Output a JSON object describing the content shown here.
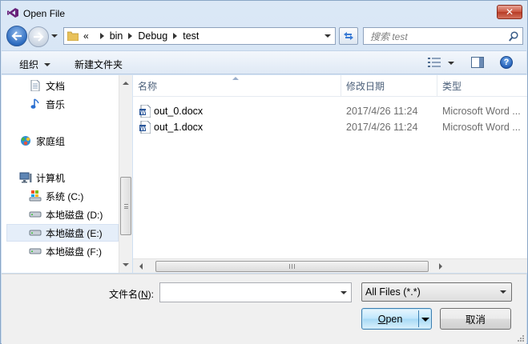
{
  "window": {
    "title": "Open File"
  },
  "nav": {
    "address": {
      "overflow": "«",
      "crumbs": [
        "bin",
        "Debug",
        "test"
      ]
    },
    "search": {
      "placeholder": "搜索 test"
    }
  },
  "toolbar": {
    "organize": "组织",
    "new_folder": "新建文件夹"
  },
  "sidebar": {
    "items": [
      {
        "label": "文档",
        "icon": "document-icon",
        "selected": false
      },
      {
        "label": "音乐",
        "icon": "music-icon",
        "selected": false
      },
      {
        "label": "家庭组",
        "icon": "homegroup-icon",
        "selected": false
      },
      {
        "label": "计算机",
        "icon": "computer-icon",
        "selected": false
      },
      {
        "label": "系统 (C:)",
        "icon": "system-drive-icon",
        "selected": false
      },
      {
        "label": "本地磁盘 (D:)",
        "icon": "drive-icon",
        "selected": false
      },
      {
        "label": "本地磁盘 (E:)",
        "icon": "drive-icon",
        "selected": true
      },
      {
        "label": "本地磁盘 (F:)",
        "icon": "drive-icon",
        "selected": false
      }
    ]
  },
  "filelist": {
    "columns": [
      "名称",
      "修改日期",
      "类型"
    ],
    "rows": [
      {
        "name": "out_0.docx",
        "date": "2017/4/26 11:24",
        "type": "Microsoft Word ..."
      },
      {
        "name": "out_1.docx",
        "date": "2017/4/26 11:24",
        "type": "Microsoft Word ..."
      }
    ]
  },
  "bottom": {
    "filename_label_pre": "文件名(",
    "filename_label_key": "N",
    "filename_label_post": "):",
    "filename_value": "",
    "filter": "All Files (*.*)",
    "open_key": "O",
    "open_rest": "pen",
    "cancel": "取消"
  },
  "colors": {
    "accent": "#3c7fb1",
    "selection": "#e5eef9",
    "window_bg": "#cfe0f1"
  }
}
